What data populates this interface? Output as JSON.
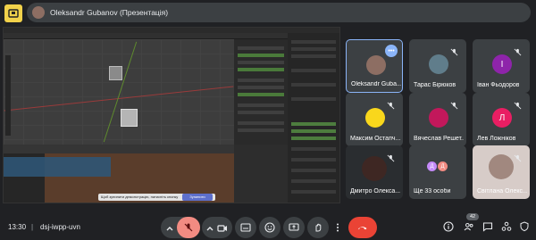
{
  "header": {
    "presenter_text": "Oleksandr Gubanov (Презентація)"
  },
  "shared_screen": {
    "tooltip": "Щоб зупинити демонстрацію, натисніть кнопку",
    "tooltip_button": "Зупинити"
  },
  "tiles": [
    {
      "name": "Oleksandr Guba...",
      "initial": "",
      "color": "#8d6e63"
    },
    {
      "name": "Тарас Бірюков",
      "initial": "",
      "color": "#607d8b"
    },
    {
      "name": "Іван Фьодоров",
      "initial": "І",
      "color": "#8e24aa"
    },
    {
      "name": "Максим Остапч...",
      "initial": "",
      "color": "#f9d71c"
    },
    {
      "name": "Вячеслав Решет...",
      "initial": "",
      "color": "#c2185b"
    },
    {
      "name": "Лев Ложніков",
      "initial": "Л",
      "color": "#e91e63"
    },
    {
      "name": "Дмитро Олекса...",
      "initial": "",
      "color": "#3e2723"
    },
    {
      "name": "Ще 33 особи",
      "initial": "Д",
      "color": "#c58af9"
    },
    {
      "name": "Світлана Олекс...",
      "initial": "",
      "color": "#d7ccc8"
    }
  ],
  "footer": {
    "time": "13:30",
    "separator": "|",
    "meeting_code": "dsj-iwpp-uvn",
    "participants_count": "42"
  },
  "colors": {
    "accent": "#8ab4f8",
    "end_call": "#ea4335",
    "mic_off": "#f28b82",
    "tile_bg": "#3c4043",
    "page_bg": "#202124"
  }
}
